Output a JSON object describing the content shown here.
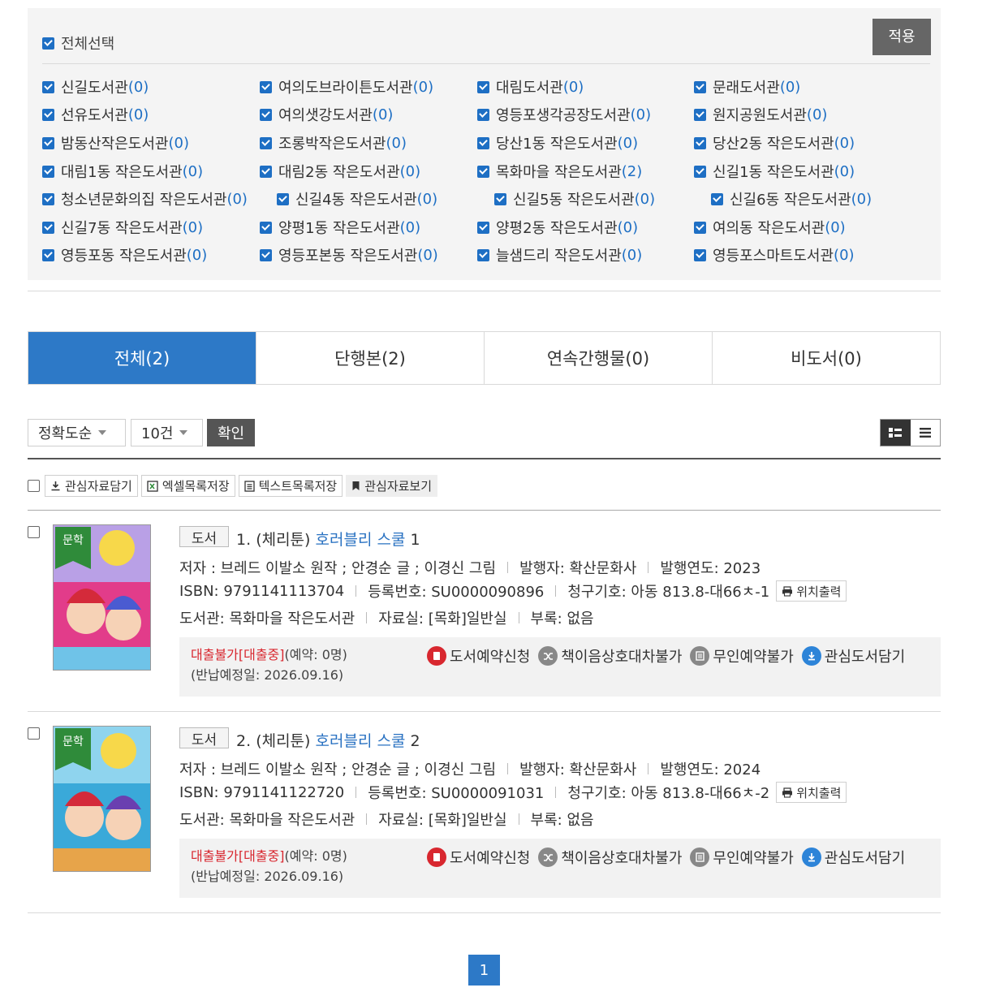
{
  "filter": {
    "select_all_label": "전체선택",
    "apply_label": "적용",
    "libraries": [
      {
        "name": "신길도서관",
        "count": "(0)"
      },
      {
        "name": "여의도브라이튼도서관",
        "count": "(0)"
      },
      {
        "name": "대림도서관",
        "count": "(0)"
      },
      {
        "name": "문래도서관",
        "count": "(0)"
      },
      {
        "name": "선유도서관",
        "count": "(0)"
      },
      {
        "name": "여의샛강도서관",
        "count": "(0)"
      },
      {
        "name": "영등포생각공장도서관",
        "count": "(0)"
      },
      {
        "name": "원지공원도서관",
        "count": "(0)"
      },
      {
        "name": "밤동산작은도서관",
        "count": "(0)"
      },
      {
        "name": "조롱박작은도서관",
        "count": "(0)"
      },
      {
        "name": "당산1동 작은도서관",
        "count": "(0)"
      },
      {
        "name": "당산2동 작은도서관",
        "count": "(0)"
      },
      {
        "name": "대림1동 작은도서관",
        "count": "(0)"
      },
      {
        "name": "대림2동 작은도서관",
        "count": "(0)"
      },
      {
        "name": "목화마을 작은도서관",
        "count": "(2)"
      },
      {
        "name": "신길1동 작은도서관",
        "count": "(0)"
      },
      {
        "name": "청소년문화의집 작은도서관",
        "count": "(0)"
      },
      {
        "name": "신길4동 작은도서관",
        "count": "(0)"
      },
      {
        "name": "신길5동 작은도서관",
        "count": "(0)"
      },
      {
        "name": "신길6동 작은도서관",
        "count": "(0)"
      },
      {
        "name": "신길7동 작은도서관",
        "count": "(0)"
      },
      {
        "name": "양평1동 작은도서관",
        "count": "(0)"
      },
      {
        "name": "양평2동 작은도서관",
        "count": "(0)"
      },
      {
        "name": "여의동 작은도서관",
        "count": "(0)"
      },
      {
        "name": "영등포동 작은도서관",
        "count": "(0)"
      },
      {
        "name": "영등포본동 작은도서관",
        "count": "(0)"
      },
      {
        "name": "늘샘드리 작은도서관",
        "count": "(0)"
      },
      {
        "name": "영등포스마트도서관",
        "count": "(0)"
      }
    ]
  },
  "tabs": [
    {
      "label": "전체(2)"
    },
    {
      "label": "단행본(2)"
    },
    {
      "label": "연속간행물(0)"
    },
    {
      "label": "비도서(0)"
    }
  ],
  "sort": {
    "order_value": "정확도순",
    "size_value": "10건",
    "confirm_label": "확인"
  },
  "toolbar": {
    "add_interest": "관심자료담기",
    "save_excel": "엑셀목록저장",
    "save_text": "텍스트목록저장",
    "view_interest": "관심자료보기"
  },
  "results": [
    {
      "type": "도서",
      "number": "1.",
      "prefix": "(체리툰)",
      "title": "호러블리 스쿨",
      "volume": "1",
      "author": "저자 : 브레드 이발소 원작 ; 안경순 글 ; 이경신 그림",
      "publisher": "발행자: 확산문화사",
      "year": "발행연도: 2023",
      "isbn": "ISBN: 9791141113704",
      "reg_no": "등록번호: SU0000090896",
      "call_no": "청구기호: 아동 813.8-대66ㅊ-1",
      "location_print": "위치출력",
      "library": "도서관: 목화마을 작은도서관",
      "room": "자료실: [목화]일반실",
      "appendix": "부록: 없음",
      "loan_status": "대출불가[대출중]",
      "reservation": "(예약: 0명)",
      "due_date": "(반납예정일: 2026.09.16)",
      "cover_tag": "문학",
      "actions": {
        "reserve": "도서예약신청",
        "interloan": "책이음상호대차불가",
        "unmanned": "무인예약불가",
        "interest": "관심도서담기"
      }
    },
    {
      "type": "도서",
      "number": "2.",
      "prefix": "(체리툰)",
      "title": "호러블리 스쿨",
      "volume": "2",
      "author": "저자 : 브레드 이발소 원작 ; 안경순 글 ; 이경신 그림",
      "publisher": "발행자: 확산문화사",
      "year": "발행연도: 2024",
      "isbn": "ISBN: 9791141122720",
      "reg_no": "등록번호: SU0000091031",
      "call_no": "청구기호: 아동 813.8-대66ㅊ-2",
      "location_print": "위치출력",
      "library": "도서관: 목화마을 작은도서관",
      "room": "자료실: [목화]일반실",
      "appendix": "부록: 없음",
      "loan_status": "대출불가[대출중]",
      "reservation": "(예약: 0명)",
      "due_date": "(반납예정일: 2026.09.16)",
      "cover_tag": "문학",
      "actions": {
        "reserve": "도서예약신청",
        "interloan": "책이음상호대차불가",
        "unmanned": "무인예약불가",
        "interest": "관심도서담기"
      }
    }
  ],
  "pagination": {
    "current": "1"
  },
  "colors": {
    "accent": "#2d79c7",
    "link": "#2a72c2",
    "danger": "#d8272f"
  }
}
